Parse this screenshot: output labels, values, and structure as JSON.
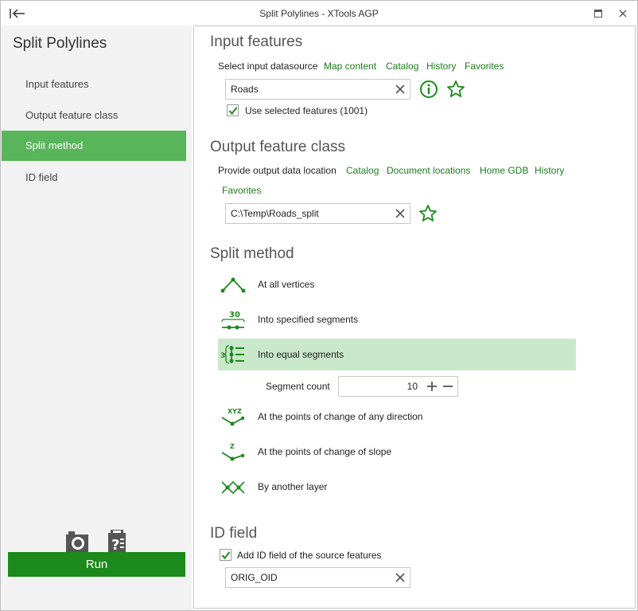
{
  "window": {
    "title": "Split Polylines  -  XTools AGP"
  },
  "sidebar": {
    "app_title": "Split Polylines",
    "items": [
      {
        "label": "Input features"
      },
      {
        "label": "Output feature class"
      },
      {
        "label": "Split method"
      },
      {
        "label": "ID field"
      }
    ],
    "run_label": "Run"
  },
  "input": {
    "title": "Input features",
    "select_label": "Select input datasource",
    "links": [
      "Map content",
      "Catalog",
      "History",
      "Favorites"
    ],
    "value": "Roads",
    "use_selected_label": "Use selected features (1001)"
  },
  "output": {
    "title": "Output feature class",
    "location_label": "Provide output data location",
    "links": [
      "Catalog",
      "Document locations",
      "Home GDB",
      "History",
      "Favorites"
    ],
    "value": "C:\\Temp\\Roads_split"
  },
  "split": {
    "title": "Split method",
    "methods": [
      {
        "label": "At all vertices",
        "icon": "vertices-icon"
      },
      {
        "label": "Into specified segments",
        "icon": "segment-length-icon",
        "icon_text": "30"
      },
      {
        "label": "Into equal segments",
        "icon": "equal-segments-icon",
        "icon_text": "3"
      },
      {
        "label": "At the points of change of any direction",
        "icon": "xyz-direction-icon",
        "icon_text": "XYZ"
      },
      {
        "label": "At the points of change of slope",
        "icon": "z-slope-icon",
        "icon_text": "Z"
      },
      {
        "label": "By another layer",
        "icon": "intersect-layer-icon"
      }
    ],
    "selected_index": 2,
    "segment_count_label": "Segment count",
    "segment_count": "10"
  },
  "idfield": {
    "title": "ID field",
    "add_label": "Add ID field of the source features",
    "value": "ORIG_OID"
  },
  "colors": {
    "accent": "#1c8a1c",
    "nav_active": "#58b55a",
    "method_active": "#c9e8c9"
  }
}
